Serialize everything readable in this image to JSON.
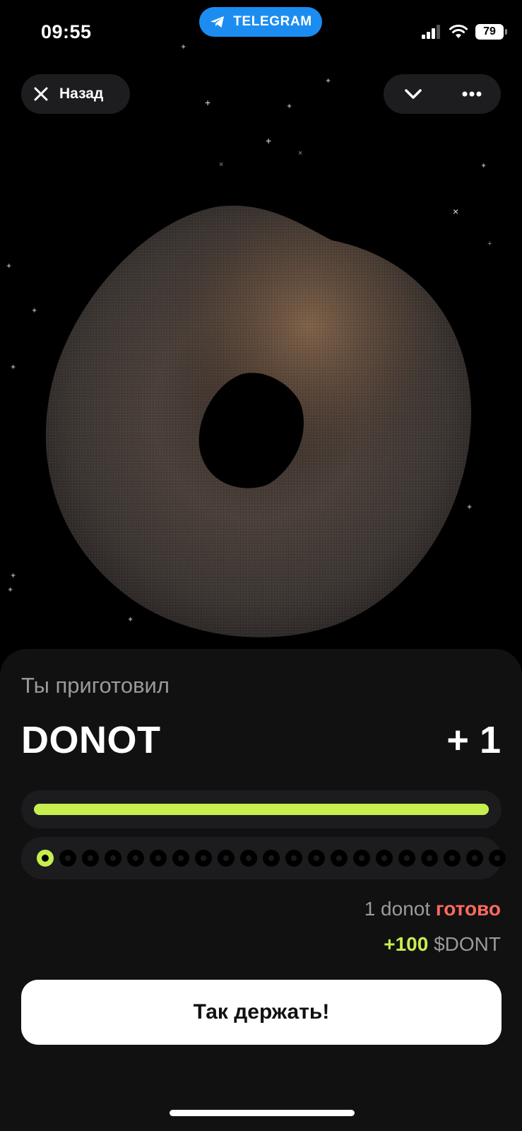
{
  "status": {
    "time": "09:55",
    "app_pill": "TELEGRAM",
    "battery": "79"
  },
  "nav": {
    "back_label": "Назад"
  },
  "result": {
    "subtitle": "Ты приготовил",
    "item_name": "DONOT",
    "count": "+ 1",
    "progress_fraction": 1.0,
    "steps_total": 21,
    "steps_done": 1,
    "ready_count": "1 donot",
    "ready_word": "готово",
    "reward_amount": "+100",
    "reward_currency": "$DONT"
  },
  "cta": {
    "label": "Так держать!"
  },
  "colors": {
    "accent_green": "#c6ee4f",
    "accent_red": "#ff6a5f",
    "telegram_blue": "#1c8df0",
    "sheet_bg": "#111112"
  }
}
